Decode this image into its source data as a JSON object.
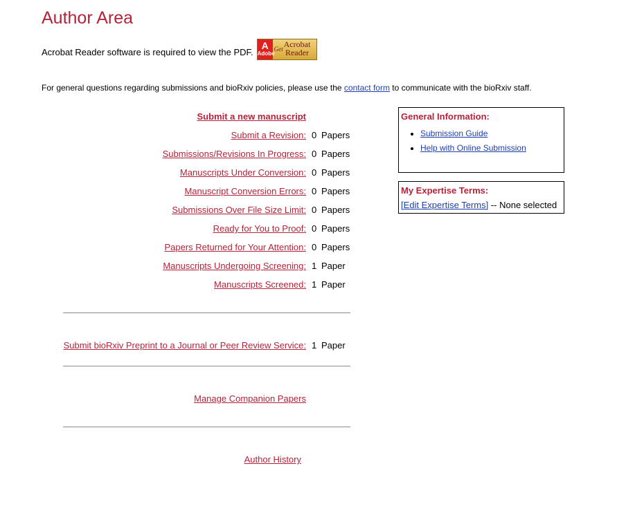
{
  "page": {
    "title": "Author Area"
  },
  "acrobat": {
    "text": "Acrobat Reader software is required to view the PDF.",
    "badge_get": "Get",
    "badge_product_line1": "Acrobat",
    "badge_product_line2": "Reader",
    "badge_adobe": "Adobe"
  },
  "general_question": {
    "before": "For general questions regarding submissions and bioRxiv policies, please use the",
    "link": "contact form",
    "after": "to communicate with the bioRxiv staff."
  },
  "manuscripts": {
    "submit_new": "Submit a new manuscript",
    "rows": [
      {
        "label": "Submit a Revision:",
        "count": "0",
        "unit": "Papers"
      },
      {
        "label": "Submissions/Revisions In Progress:",
        "count": "0",
        "unit": "Papers"
      },
      {
        "label": "Manuscripts Under Conversion:",
        "count": "0",
        "unit": "Papers"
      },
      {
        "label": "Manuscript Conversion Errors:",
        "count": "0",
        "unit": "Papers"
      },
      {
        "label": "Submissions Over File Size Limit:",
        "count": "0",
        "unit": "Papers"
      },
      {
        "label": "Ready for You to Proof:",
        "count": "0",
        "unit": "Papers"
      },
      {
        "label": "Papers Returned for Your Attention:",
        "count": "0",
        "unit": "Papers"
      },
      {
        "label": "Manuscripts Undergoing Screening:",
        "count": "1",
        "unit": "Paper"
      },
      {
        "label": "Manuscripts Screened:",
        "count": "1",
        "unit": "Paper"
      }
    ],
    "preprint": {
      "label": "Submit bioRxiv Preprint to a Journal or Peer Review Service:",
      "count": "1",
      "unit": "Paper"
    },
    "companion": "Manage Companion Papers",
    "history": "Author History"
  },
  "general_info": {
    "heading": "General Information:",
    "links": [
      "Submission Guide",
      "Help with Online Submission"
    ]
  },
  "expertise": {
    "heading": "My Expertise Terms:",
    "edit_link": "[Edit Expertise Terms]",
    "status": "-- None selected"
  }
}
